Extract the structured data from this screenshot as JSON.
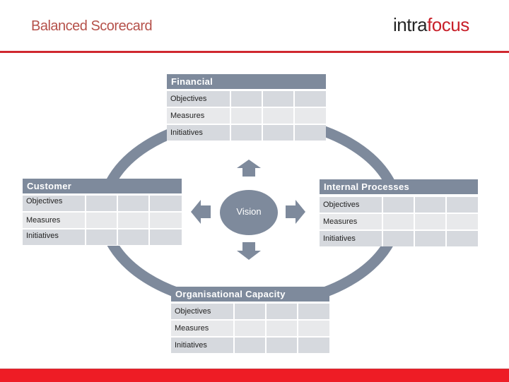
{
  "header": {
    "title": "Balanced Scorecard",
    "logo_part1": "intra",
    "logo_part2": "focus"
  },
  "colors": {
    "title": "#b5514a",
    "accent_red": "#ee1c25",
    "header_fill": "#7e8a9c",
    "row_dark": "#d6d9de",
    "row_light": "#e8e9eb"
  },
  "center": {
    "label": "Vision"
  },
  "arrows": [
    "up-arrow",
    "down-arrow",
    "left-arrow",
    "right-arrow"
  ],
  "perspectives": {
    "financial": {
      "title": "Financial",
      "rows": [
        "Objectives",
        "Measures",
        "Initiatives"
      ]
    },
    "customer": {
      "title": "Customer",
      "rows": [
        "Objectives",
        "Measures",
        "Initiatives"
      ]
    },
    "internal": {
      "title": "Internal Processes",
      "rows": [
        "Objectives",
        "Measures",
        "Initiatives"
      ]
    },
    "capacity": {
      "title": "Organisational Capacity",
      "rows": [
        "Objectives",
        "Measures",
        "Initiatives"
      ]
    }
  }
}
